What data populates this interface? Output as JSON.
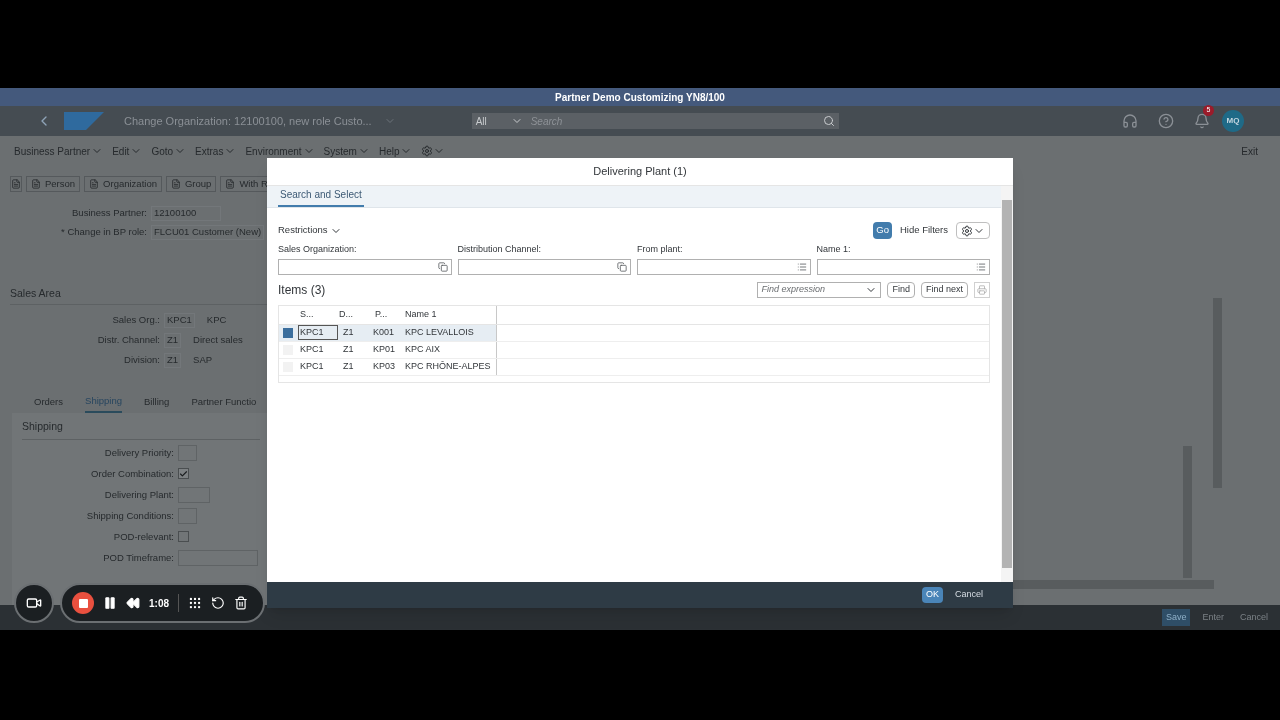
{
  "window": {
    "title": "Partner Demo Customizing YN8/100"
  },
  "shell_bar": {
    "title": "Change Organization: 12100100, new role Custo...",
    "search_scope": "All",
    "search": {
      "placeholder": "Search"
    },
    "notification_count": "5",
    "avatar": "MQ"
  },
  "menu_bar": {
    "items": [
      "Business Partner",
      "Edit",
      "Goto",
      "Extras",
      "Environment",
      "System",
      "Help"
    ],
    "exit": "Exit"
  },
  "toolbar": {
    "buttons": [
      "Person",
      "Organization",
      "Group",
      "With R"
    ]
  },
  "header_fields": [
    {
      "label": "Business Partner:",
      "value": "12100100"
    },
    {
      "label": "* Change in BP role:",
      "value": "FLCU01 Customer (New)"
    }
  ],
  "sales_area": {
    "title": "Sales Area",
    "fields": [
      {
        "label": "Sales Org.:",
        "value": "KPC1",
        "description": "KPC"
      },
      {
        "label": "Distr. Channel:",
        "value": "Z1",
        "description": "Direct sales"
      },
      {
        "label": "Division:",
        "value": "Z1",
        "description": "SAP"
      }
    ]
  },
  "tabs": [
    {
      "label": "Orders",
      "selected": false
    },
    {
      "label": "Shipping",
      "selected": true
    },
    {
      "label": "Billing",
      "selected": false
    },
    {
      "label": "Partner Functio",
      "selected": false
    }
  ],
  "shipping": {
    "title": "Shipping",
    "fields": [
      {
        "kind": "input",
        "label": "Delivery Priority:"
      },
      {
        "kind": "checkbox",
        "label": "Order Combination:",
        "checked": true
      },
      {
        "kind": "input",
        "label": "Delivering Plant:"
      },
      {
        "kind": "input",
        "label": "Shipping Conditions:"
      },
      {
        "kind": "checkbox",
        "label": "POD-relevant:",
        "checked": false
      },
      {
        "kind": "input",
        "label": "POD Timeframe:"
      }
    ]
  },
  "footer": {
    "buttons": [
      {
        "label": "Save",
        "disabled": true
      },
      {
        "label": "Enter",
        "disabled": false
      },
      {
        "label": "Cancel",
        "disabled": false
      }
    ]
  },
  "dialog": {
    "title": "Delivering Plant (1)",
    "tabs": [
      {
        "label": "Search and Select",
        "selected": true
      }
    ],
    "restrictions": "Restrictions",
    "go": "Go",
    "hide_filters": "Hide Filters",
    "filters": [
      {
        "label": "Sales Organization:",
        "kind": "copy"
      },
      {
        "label": "Distribution Channel:",
        "kind": "copy"
      },
      {
        "label": "From plant:",
        "kind": "list"
      },
      {
        "label": "Name 1:",
        "kind": "list"
      }
    ],
    "items_title": "Items (3)",
    "find": {
      "placeholder": "Find expression"
    },
    "find_buttons": [
      "Find",
      "Find next"
    ],
    "table": {
      "columns": [
        "S...",
        "D...",
        "P...",
        "Name 1"
      ],
      "rows": [
        {
          "cells": [
            "KPC1",
            "Z1",
            "K001",
            "KPC LEVALLOIS"
          ],
          "selected": true
        },
        {
          "cells": [
            "KPC1",
            "Z1",
            "KP01",
            "KPC AIX"
          ],
          "selected": false
        },
        {
          "cells": [
            "KPC1",
            "Z1",
            "KP03",
            "KPC RHÔNE-ALPES"
          ],
          "selected": false
        }
      ]
    },
    "buttons": [
      {
        "label": "OK",
        "kind": "primary"
      },
      {
        "label": "Cancel",
        "kind": "plain"
      }
    ]
  },
  "recorder": {
    "time": "1:08"
  }
}
